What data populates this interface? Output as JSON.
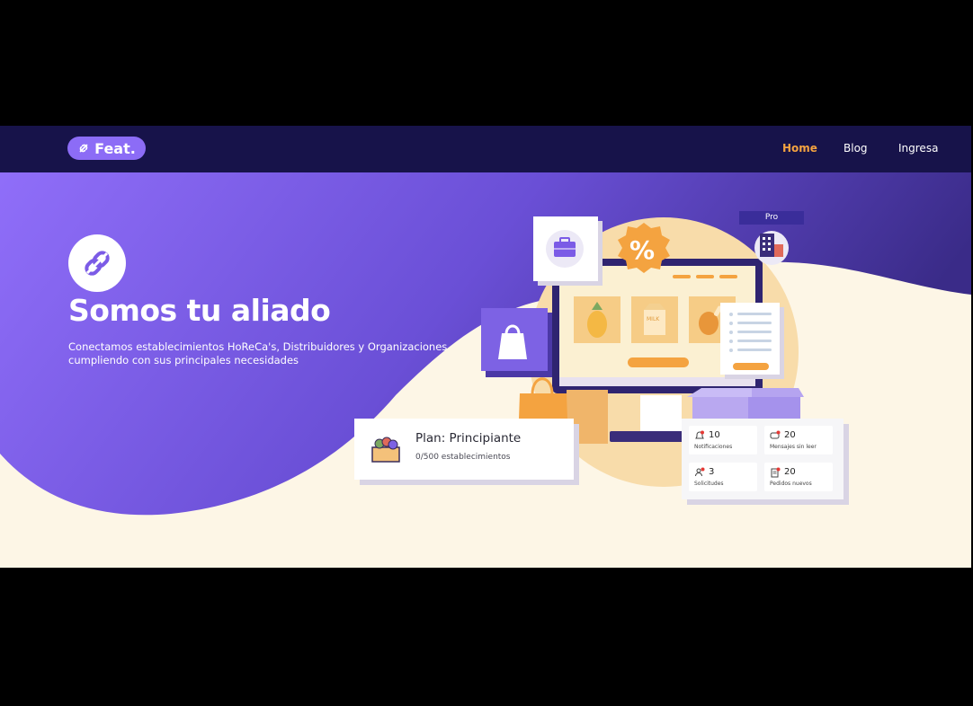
{
  "brand": {
    "name": "Feat."
  },
  "nav": {
    "items": [
      {
        "label": "Home",
        "active": true
      },
      {
        "label": "Blog",
        "active": false
      },
      {
        "label": "Ingresa",
        "active": false
      }
    ]
  },
  "hero": {
    "title": "Somos tu aliado",
    "subtitle": "Conectamos establecimientos HoReCa's, Distribuidores y Organizaciones cumpliendo con sus principales necesidades"
  },
  "illustration": {
    "pro_badge": "Pro",
    "discount_symbol": "%",
    "milk_label": "MILK",
    "plan": {
      "title": "Plan: Principiante",
      "subtitle": "0/500 establecimientos"
    },
    "stats": [
      {
        "value": "10",
        "label": "Notificaciones"
      },
      {
        "value": "20",
        "label": "Mensajes sin leer"
      },
      {
        "value": "3",
        "label": "Solicitudes"
      },
      {
        "value": "20",
        "label": "Pedidos nuevos"
      }
    ]
  },
  "colors": {
    "navbar": "#17134a",
    "purple": "#8c6cf6",
    "accent_orange": "#f4a340",
    "cream": "#fdf6e6"
  }
}
